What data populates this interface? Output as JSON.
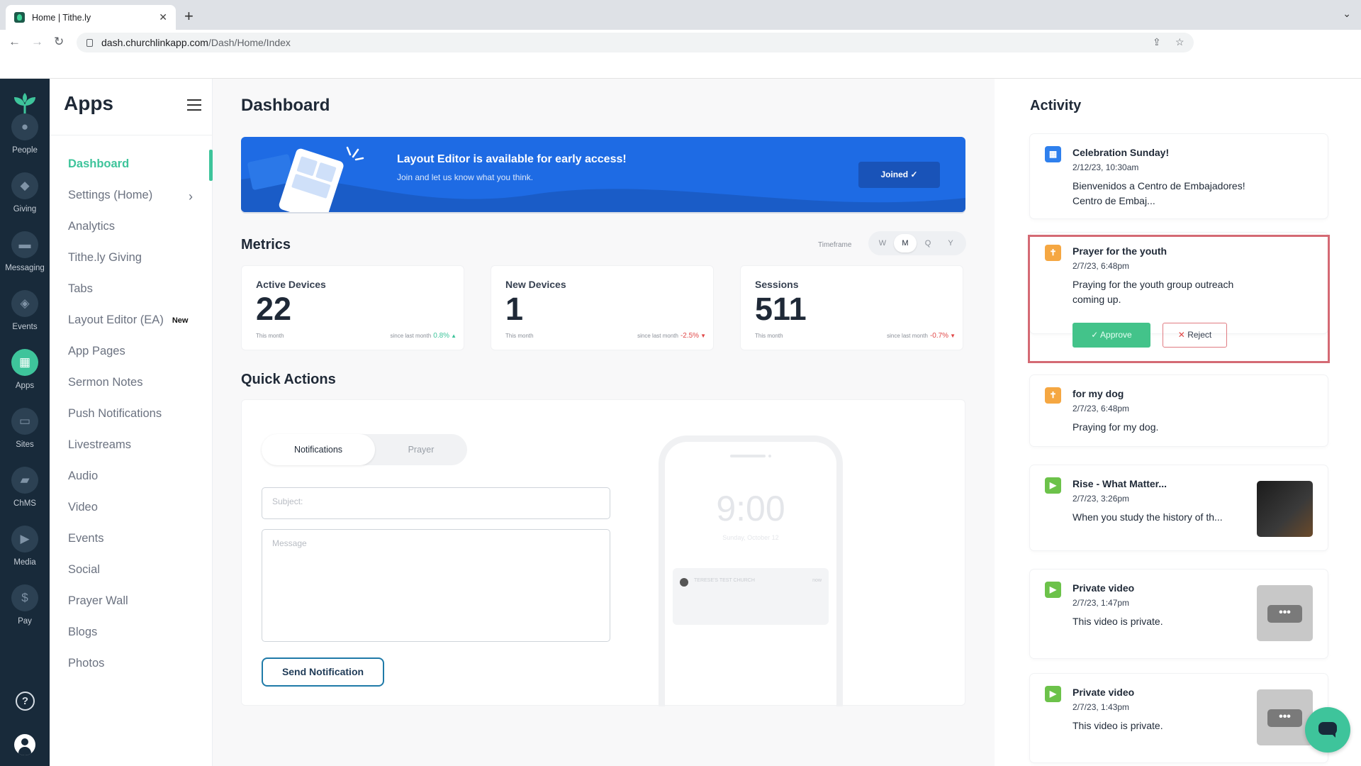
{
  "browser": {
    "tab_title": "Home | Tithe.ly",
    "url_domain": "dash.churchlinkapp.com",
    "url_path": "/Dash/Home/Index"
  },
  "rail": {
    "items": [
      {
        "label": "People",
        "icon": "people-icon"
      },
      {
        "label": "Giving",
        "icon": "leaf-icon"
      },
      {
        "label": "Messaging",
        "icon": "chat-icon"
      },
      {
        "label": "Events",
        "icon": "calendar-icon"
      },
      {
        "label": "Apps",
        "icon": "apps-grid-icon",
        "active": true
      },
      {
        "label": "Sites",
        "icon": "browser-icon"
      },
      {
        "label": "ChMS",
        "icon": "folder-icon"
      },
      {
        "label": "Media",
        "icon": "play-icon"
      },
      {
        "label": "Pay",
        "icon": "dollar-icon"
      }
    ],
    "help": "?"
  },
  "sidenav": {
    "title": "Apps",
    "items": [
      {
        "label": "Dashboard",
        "active": true
      },
      {
        "label": "Settings (Home)"
      },
      {
        "label": "Analytics"
      },
      {
        "label": "Tithe.ly Giving"
      },
      {
        "label": "Tabs"
      },
      {
        "label": "Layout Editor (EA)",
        "badge": "New"
      },
      {
        "label": "App Pages"
      },
      {
        "label": "Sermon Notes"
      },
      {
        "label": "Push Notifications"
      },
      {
        "label": "Livestreams"
      },
      {
        "label": "Audio"
      },
      {
        "label": "Video"
      },
      {
        "label": "Events"
      },
      {
        "label": "Social"
      },
      {
        "label": "Prayer Wall"
      },
      {
        "label": "Blogs"
      },
      {
        "label": "Photos"
      }
    ]
  },
  "main": {
    "title": "Dashboard",
    "banner": {
      "title": "Layout Editor is available for early access!",
      "subtitle": "Join and let us know what you think.",
      "button": "Joined ✓"
    },
    "metrics": {
      "title": "Metrics",
      "timeframe_label": "Timeframe",
      "timeframes": [
        "W",
        "M",
        "Q",
        "Y"
      ],
      "selected": "M",
      "cards": [
        {
          "label": "Active Devices",
          "value": "22",
          "period": "This month",
          "since": "since last month",
          "change": "0.8%",
          "dir": "up",
          "arrow": "▲"
        },
        {
          "label": "New Devices",
          "value": "1",
          "period": "This month",
          "since": "since last month",
          "change": "-2.5%",
          "dir": "down",
          "arrow": "▼"
        },
        {
          "label": "Sessions",
          "value": "511",
          "period": "This month",
          "since": "since last month",
          "change": "-0.7%",
          "dir": "down",
          "arrow": "▼"
        }
      ]
    },
    "quick_actions": {
      "title": "Quick Actions",
      "tabs": [
        "Notifications",
        "Prayer"
      ],
      "subject_placeholder": "Subject:",
      "message_placeholder": "Message",
      "send_button": "Send Notification",
      "phone": {
        "time": "9:00",
        "date": "Sunday, October 12",
        "church": "TERESE'S TEST CHURCH",
        "now": "now"
      }
    }
  },
  "activity": {
    "title": "Activity",
    "items": [
      {
        "title": "Celebration Sunday!",
        "date": "2/12/23, 10:30am",
        "body": "Bienvenidos a Centro de Embajadores! Centro de Embaj...",
        "icon": "calendar-icon",
        "color": "#2f80ed"
      },
      {
        "title": "Prayer for the youth",
        "date": "2/7/23, 6:48pm",
        "body": "Praying for the youth group outreach coming up.",
        "icon": "prayer-icon",
        "color": "#f5a742",
        "approve": "Approve",
        "reject": "Reject"
      },
      {
        "title": "for my dog",
        "date": "2/7/23, 6:48pm",
        "body": "Praying for my dog.",
        "icon": "prayer-icon",
        "color": "#f5a742"
      },
      {
        "title": "Rise - What Matter...",
        "date": "2/7/23, 3:26pm",
        "body": "When you study the history of th...",
        "icon": "video-icon",
        "color": "#6cc24a"
      },
      {
        "title": "Private video",
        "date": "2/7/23, 1:47pm",
        "body": "This video is private.",
        "icon": "video-icon",
        "color": "#6cc24a"
      },
      {
        "title": "Private video",
        "date": "2/7/23, 1:43pm",
        "body": "This video is private.",
        "icon": "video-icon",
        "color": "#6cc24a"
      }
    ]
  }
}
